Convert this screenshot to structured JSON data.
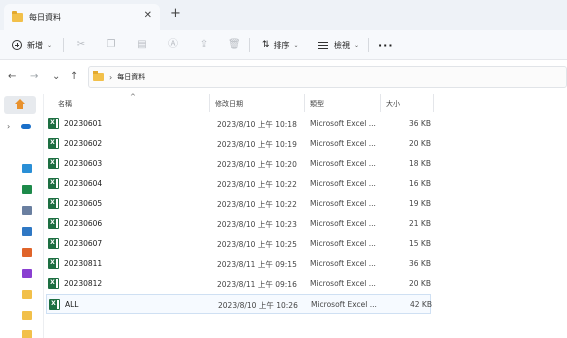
{
  "tab": {
    "title": "每日資料",
    "close": "✕",
    "add": "+"
  },
  "toolbar": {
    "new_label": "新增",
    "sort_label": "排序",
    "view_label": "檢視",
    "more": "···",
    "chevron": "⌄"
  },
  "nav": {
    "back": "←",
    "forward": "→",
    "recent": "⌄",
    "up": "↑",
    "breadcrumb_sep": "›",
    "path": "每日資料"
  },
  "columns": {
    "name": "名稱",
    "date": "修改日期",
    "type": "類型",
    "size": "大小",
    "sort_indicator": "^"
  },
  "files": [
    {
      "name": "20230601",
      "date": "2023/8/10 上午 10:18",
      "type": "Microsoft Excel ...",
      "size": "36 KB"
    },
    {
      "name": "20230602",
      "date": "2023/8/10 上午 10:19",
      "type": "Microsoft Excel ...",
      "size": "20 KB"
    },
    {
      "name": "20230603",
      "date": "2023/8/10 上午 10:20",
      "type": "Microsoft Excel ...",
      "size": "18 KB"
    },
    {
      "name": "20230604",
      "date": "2023/8/10 上午 10:22",
      "type": "Microsoft Excel ...",
      "size": "16 KB"
    },
    {
      "name": "20230605",
      "date": "2023/8/10 上午 10:22",
      "type": "Microsoft Excel ...",
      "size": "19 KB"
    },
    {
      "name": "20230606",
      "date": "2023/8/10 上午 10:23",
      "type": "Microsoft Excel ...",
      "size": "21 KB"
    },
    {
      "name": "20230607",
      "date": "2023/8/10 上午 10:25",
      "type": "Microsoft Excel ...",
      "size": "15 KB"
    },
    {
      "name": "20230811",
      "date": "2023/8/11 上午 09:15",
      "type": "Microsoft Excel ...",
      "size": "36 KB"
    },
    {
      "name": "20230812",
      "date": "2023/8/11 上午 09:16",
      "type": "Microsoft Excel ...",
      "size": "20 KB"
    },
    {
      "name": "ALL",
      "date": "2023/8/10 上午 10:26",
      "type": "Microsoft Excel ...",
      "size": "42 KB"
    }
  ],
  "sidebar": {
    "expand": "›",
    "icon_colors": [
      "#2a8fd6",
      "#1d8a4a",
      "#6a7fa0",
      "#2f78c4",
      "#e0642a",
      "#8a3fd1",
      "#f2c04a",
      "#f2c04a",
      "#f2c04a"
    ]
  }
}
